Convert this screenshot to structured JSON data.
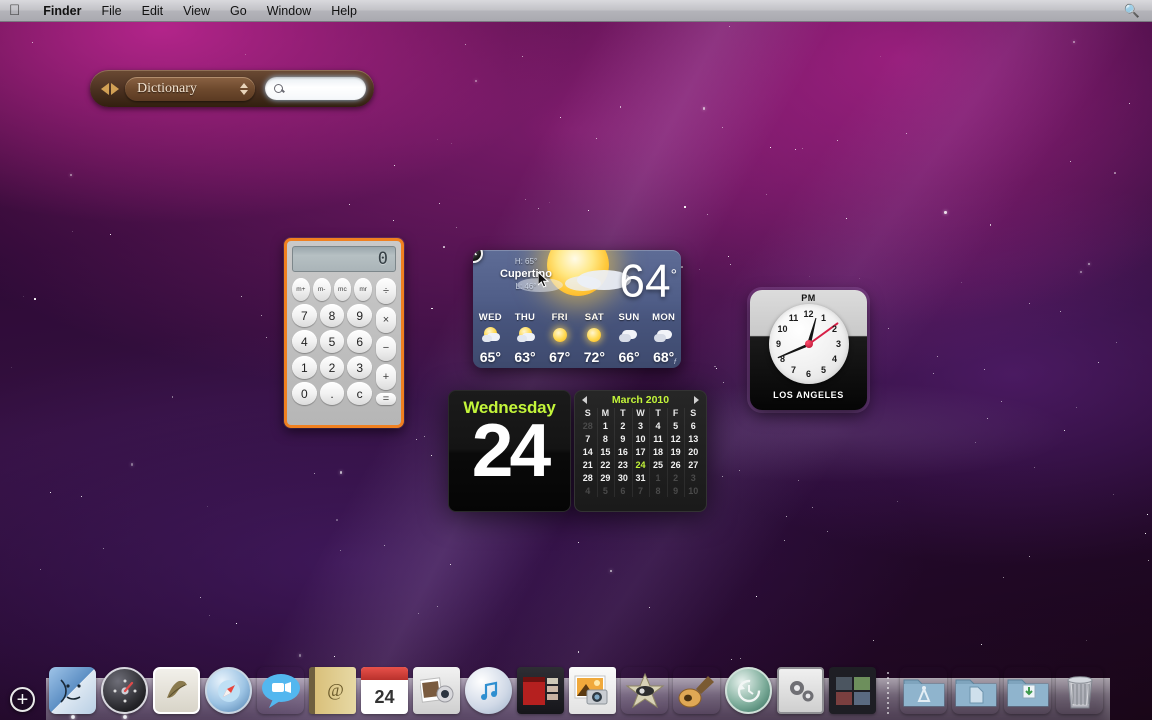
{
  "menubar": {
    "apple_glyph": "&#63743;",
    "items": [
      {
        "label": "Finder",
        "bold": true
      },
      {
        "label": "File",
        "bold": false
      },
      {
        "label": "Edit",
        "bold": false
      },
      {
        "label": "View",
        "bold": false
      },
      {
        "label": "Go",
        "bold": false
      },
      {
        "label": "Window",
        "bold": false
      },
      {
        "label": "Help",
        "bold": false
      }
    ],
    "spotlight_icon": "search-icon"
  },
  "dictionary_widget": {
    "source_label": "Dictionary",
    "search_value": "",
    "search_placeholder": "",
    "back_icon": "back-arrow-icon",
    "forward_icon": "forward-arrow-icon",
    "search_icon": "magnifier-icon"
  },
  "calculator_widget": {
    "display": "0",
    "memory_keys": [
      "m+",
      "m-",
      "mc",
      "mr"
    ],
    "number_keys": [
      [
        "7",
        "8",
        "9"
      ],
      [
        "4",
        "5",
        "6"
      ],
      [
        "1",
        "2",
        "3"
      ],
      [
        "0",
        ".",
        "c"
      ]
    ],
    "operator_keys": [
      "÷",
      "×",
      "−",
      "+"
    ],
    "equals_key": "=",
    "border_color": "#f08020",
    "selected": true
  },
  "weather_widget": {
    "city": "Cupertino",
    "current_temp": "64",
    "degree_symbol": "°",
    "high": "H: 65°",
    "low": "L: 46°",
    "unit": "f",
    "close_icon": "close-icon",
    "close_glyph": "✕",
    "forecast": [
      {
        "day": "WED",
        "temp": "65°",
        "condition": "partly-cloudy"
      },
      {
        "day": "THU",
        "temp": "63°",
        "condition": "partly-cloudy"
      },
      {
        "day": "FRI",
        "temp": "67°",
        "condition": "sunny"
      },
      {
        "day": "SAT",
        "temp": "72°",
        "condition": "sunny"
      },
      {
        "day": "SUN",
        "temp": "66°",
        "condition": "cloudy"
      },
      {
        "day": "MON",
        "temp": "68°",
        "condition": "cloudy"
      }
    ]
  },
  "calendar_widget": {
    "weekday": "Wednesday",
    "day_number": "24",
    "month_year": "March 2010",
    "prev_icon": "prev-month-icon",
    "next_icon": "next-month-icon",
    "day_initials": [
      "S",
      "M",
      "T",
      "W",
      "T",
      "F",
      "S"
    ],
    "today": "24",
    "weeks": [
      [
        {
          "n": "28",
          "dim": true
        },
        {
          "n": "1"
        },
        {
          "n": "2"
        },
        {
          "n": "3"
        },
        {
          "n": "4"
        },
        {
          "n": "5"
        },
        {
          "n": "6"
        }
      ],
      [
        {
          "n": "7"
        },
        {
          "n": "8"
        },
        {
          "n": "9"
        },
        {
          "n": "10"
        },
        {
          "n": "11"
        },
        {
          "n": "12"
        },
        {
          "n": "13"
        }
      ],
      [
        {
          "n": "14"
        },
        {
          "n": "15"
        },
        {
          "n": "16"
        },
        {
          "n": "17"
        },
        {
          "n": "18"
        },
        {
          "n": "19"
        },
        {
          "n": "20"
        }
      ],
      [
        {
          "n": "21"
        },
        {
          "n": "22"
        },
        {
          "n": "23"
        },
        {
          "n": "24",
          "today": true
        },
        {
          "n": "25"
        },
        {
          "n": "26"
        },
        {
          "n": "27"
        }
      ],
      [
        {
          "n": "28"
        },
        {
          "n": "29"
        },
        {
          "n": "30"
        },
        {
          "n": "31"
        },
        {
          "n": "1",
          "dim": true
        },
        {
          "n": "2",
          "dim": true
        },
        {
          "n": "3",
          "dim": true
        }
      ],
      [
        {
          "n": "4",
          "dim": true
        },
        {
          "n": "5",
          "dim": true
        },
        {
          "n": "6",
          "dim": true
        },
        {
          "n": "7",
          "dim": true
        },
        {
          "n": "8",
          "dim": true
        },
        {
          "n": "9",
          "dim": true
        },
        {
          "n": "10",
          "dim": true
        }
      ]
    ]
  },
  "clock_widget": {
    "meridiem": "PM",
    "city": "LOS ANGELES",
    "hour_numbers": [
      "12",
      "1",
      "2",
      "3",
      "4",
      "5",
      "6",
      "7",
      "8",
      "9",
      "10",
      "11"
    ],
    "hour_angle_deg": -75,
    "minute_angle_deg": 157,
    "second_angle_deg": -36
  },
  "dashboard": {
    "add_widget_label": "+",
    "add_widget_icon": "plus-circle-icon"
  },
  "dock": {
    "items": [
      {
        "name": "finder",
        "label": "Finder",
        "running": true
      },
      {
        "name": "dashboard",
        "label": "Dashboard",
        "running": true
      },
      {
        "name": "mail",
        "label": "Mail",
        "running": false
      },
      {
        "name": "safari",
        "label": "Safari",
        "running": false
      },
      {
        "name": "ichat",
        "label": "iChat",
        "running": false
      },
      {
        "name": "address-book",
        "label": "Address Book",
        "running": false
      },
      {
        "name": "ical",
        "label": "iCal",
        "running": false,
        "badge": "24"
      },
      {
        "name": "iphoto",
        "label": "iPhoto",
        "running": false
      },
      {
        "name": "itunes",
        "label": "iTunes",
        "running": false
      },
      {
        "name": "photo-booth",
        "label": "Photo Booth",
        "running": false
      },
      {
        "name": "preview",
        "label": "Preview",
        "running": false
      },
      {
        "name": "imovie",
        "label": "iMovie",
        "running": false
      },
      {
        "name": "garageband",
        "label": "GarageBand",
        "running": false
      },
      {
        "name": "time-machine",
        "label": "Time Machine",
        "running": false
      },
      {
        "name": "system-preferences",
        "label": "System Preferences",
        "running": false
      },
      {
        "name": "spaces",
        "label": "Spaces",
        "running": false
      }
    ],
    "folders": [
      {
        "name": "applications-folder",
        "label": "Applications"
      },
      {
        "name": "documents-folder",
        "label": "Documents"
      },
      {
        "name": "downloads-folder",
        "label": "Downloads"
      }
    ],
    "trash": {
      "name": "trash",
      "label": "Trash"
    }
  }
}
